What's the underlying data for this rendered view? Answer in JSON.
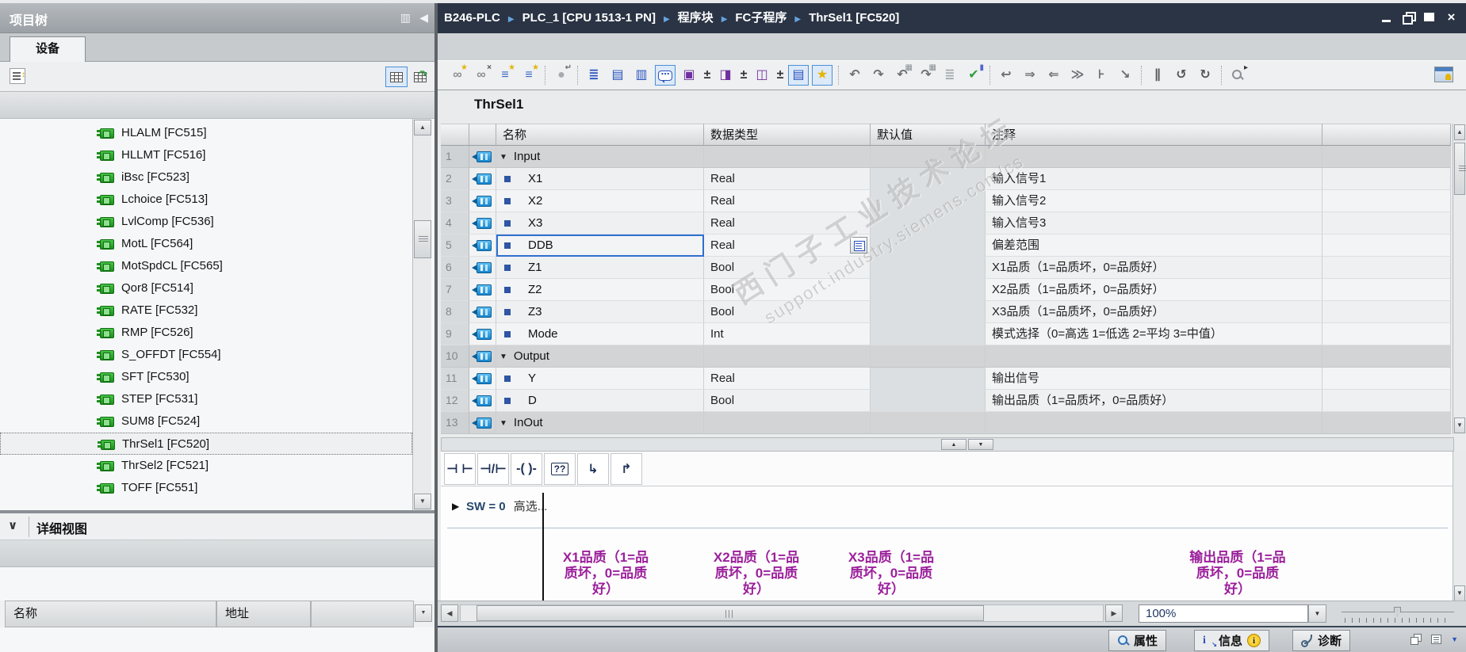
{
  "window": {
    "breadcrumb": [
      "B246-PLC",
      "PLC_1 [CPU 1513-1 PN]",
      "程序块",
      "FC子程序",
      "ThrSel1 [FC520]"
    ],
    "controls": [
      "minimize",
      "restore",
      "maximize",
      "close"
    ]
  },
  "project_tree": {
    "title": "项目树",
    "tab_label": "设备",
    "items": [
      "HLALM [FC515]",
      "HLLMT [FC516]",
      "iBsc [FC523]",
      "Lchoice [FC513]",
      "LvlComp [FC536]",
      "MotL [FC564]",
      "MotSpdCL [FC565]",
      "Qor8 [FC514]",
      "RATE [FC532]",
      "RMP [FC526]",
      "S_OFFDT [FC554]",
      "SFT [FC530]",
      "STEP [FC531]",
      "SUM8 [FC524]",
      "ThrSel1 [FC520]",
      "ThrSel2 [FC521]",
      "TOFF [FC551]"
    ],
    "selected_item": "ThrSel1 [FC520]",
    "detail_view": {
      "title": "详细视图",
      "columns": [
        "名称",
        "地址"
      ]
    }
  },
  "editor": {
    "block_title": "ThrSel1",
    "interface_table": {
      "columns": [
        "名称",
        "数据类型",
        "默认值",
        "注释"
      ],
      "rows": [
        {
          "num": "1",
          "name": "Input",
          "type": "",
          "default": "",
          "comment": "",
          "section": true
        },
        {
          "num": "2",
          "name": "X1",
          "type": "Real",
          "default": "",
          "comment": "输入信号1"
        },
        {
          "num": "3",
          "name": "X2",
          "type": "Real",
          "default": "",
          "comment": "输入信号2"
        },
        {
          "num": "4",
          "name": "X3",
          "type": "Real",
          "default": "",
          "comment": "输入信号3"
        },
        {
          "num": "5",
          "name": "DDB",
          "type": "Real",
          "default": "",
          "comment": "偏差范围",
          "editing": true
        },
        {
          "num": "6",
          "name": "Z1",
          "type": "Bool",
          "default": "",
          "comment": "X1品质（1=品质坏，0=品质好）"
        },
        {
          "num": "7",
          "name": "Z2",
          "type": "Bool",
          "default": "",
          "comment": "X2品质（1=品质坏，0=品质好）"
        },
        {
          "num": "8",
          "name": "Z3",
          "type": "Bool",
          "default": "",
          "comment": "X3品质（1=品质坏，0=品质好）"
        },
        {
          "num": "9",
          "name": "Mode",
          "type": "Int",
          "default": "",
          "comment": "模式选择（0=高选 1=低选 2=平均 3=中值）"
        },
        {
          "num": "10",
          "name": "Output",
          "type": "",
          "default": "",
          "comment": "",
          "section": true
        },
        {
          "num": "11",
          "name": "Y",
          "type": "Real",
          "default": "",
          "comment": "输出信号"
        },
        {
          "num": "12",
          "name": "D",
          "type": "Bool",
          "default": "",
          "comment": "输出品质（1=品质坏，0=品质好）"
        },
        {
          "num": "13",
          "name": "InOut",
          "type": "",
          "default": "",
          "comment": "",
          "section": true
        }
      ]
    },
    "toolbar_icons": [
      {
        "name": "insert-watch-icon",
        "glyph": "∞",
        "color": "#8a8f94",
        "badge": "★",
        "badge_color": "#e3b505"
      },
      {
        "name": "delete-watch-icon",
        "glyph": "∞",
        "color": "#8a8f94",
        "badge": "×",
        "badge_color": "#555555"
      },
      {
        "name": "insert-row-icon",
        "glyph": "≡",
        "color": "#3a66c4",
        "badge": "★",
        "badge_color": "#e3b505"
      },
      {
        "name": "add-row-after-icon",
        "glyph": "≡",
        "color": "#3a66c4",
        "badge": "★",
        "badge_color": "#e3b505"
      },
      {
        "separator": true
      },
      {
        "name": "keep-actual-values-icon",
        "glyph": "●",
        "color": "#a6abb0",
        "badge": "↵",
        "badge_color": "#666666"
      },
      {
        "separator": true
      },
      {
        "name": "network-sequence-icon",
        "glyph": "≣",
        "color": "#2a52be"
      },
      {
        "name": "open-all-networks-icon",
        "glyph": "▤",
        "color": "#2a52be"
      },
      {
        "name": "close-all-networks-icon",
        "glyph": "▥",
        "color": "#2a52be"
      },
      {
        "name": "comments-toggle-icon",
        "glyph": "⋯",
        "color": "#2a52be",
        "bubble": true,
        "toggled": true
      },
      {
        "name": "tag-info-icon",
        "glyph": "▣",
        "color": "#7030a0"
      },
      {
        "name": "tag-info-expand-icon",
        "glyph": "±",
        "color": "#333333",
        "narrow": true
      },
      {
        "name": "tag-comment-icon",
        "glyph": "◨",
        "color": "#7030a0"
      },
      {
        "name": "tag-comment-expand-icon",
        "glyph": "±",
        "color": "#333333",
        "narrow": true
      },
      {
        "name": "tag-address-icon",
        "glyph": "◫",
        "color": "#7030a0"
      },
      {
        "name": "tag-address-expand-icon",
        "glyph": "±",
        "color": "#333333",
        "narrow": true
      },
      {
        "name": "absolute-operands-toggle-icon",
        "glyph": "▤",
        "color": "#2a52be",
        "toggled": true
      },
      {
        "name": "favorites-toggle-icon",
        "glyph": "★",
        "color": "#e3b505",
        "toggled": true
      },
      {
        "separator": true
      },
      {
        "name": "undo-icon",
        "glyph": "↶",
        "color": "#6b7075"
      },
      {
        "name": "redo-icon",
        "glyph": "↷",
        "color": "#6b7075"
      },
      {
        "name": "download-to-device-icon",
        "glyph": "↶",
        "color": "#6b7075",
        "badge": "▦",
        "badge_color": "#8a8f94"
      },
      {
        "name": "upload-from-device-icon",
        "glyph": "↷",
        "color": "#6b7075",
        "badge": "▦",
        "badge_color": "#8a8f94"
      },
      {
        "name": "compare-icon",
        "glyph": "≣",
        "color": "#a6abb0"
      },
      {
        "name": "compile-icon",
        "glyph": "✔",
        "color": "#2e9e3f",
        "badge": "▮",
        "badge_color": "#5566cc"
      },
      {
        "separator": true
      },
      {
        "name": "goto-definition-icon",
        "glyph": "↩",
        "color": "#6b7075"
      },
      {
        "name": "goto-next-usage-icon",
        "glyph": "⇒",
        "color": "#6b7075"
      },
      {
        "name": "goto-previous-usage-icon",
        "glyph": "⇐",
        "color": "#6b7075"
      },
      {
        "name": "update-block-calls-icon",
        "glyph": "≫",
        "color": "#6b7075"
      },
      {
        "name": "insert-network-icon",
        "glyph": "⊦",
        "color": "#6b7075"
      },
      {
        "name": "delete-network-icon",
        "glyph": "↘",
        "color": "#6b7075"
      },
      {
        "separator": true
      },
      {
        "name": "pause-icon",
        "glyph": "∥",
        "color": "#555555"
      },
      {
        "name": "jump-back-icon",
        "glyph": "↺",
        "color": "#555555"
      },
      {
        "name": "jump-forward-icon",
        "glyph": "↻",
        "color": "#555555"
      },
      {
        "separator": true
      },
      {
        "name": "search-icon",
        "magnifier": true,
        "badge": "▸",
        "badge_color": "#333333"
      }
    ],
    "ladder_toolbar": [
      {
        "name": "no-contact-button",
        "label": "⊣ ⊢"
      },
      {
        "name": "nc-contact-button",
        "label": "⊣/⊢"
      },
      {
        "name": "coil-button",
        "label": "-( )-"
      },
      {
        "name": "empty-box-button",
        "label": "??",
        "boxed": true
      },
      {
        "name": "open-branch-button",
        "label": "↳"
      },
      {
        "name": "close-branch-button",
        "label": "↱"
      }
    ],
    "network": {
      "title_prefix": "SW = 0",
      "title_suffix": "高选...",
      "operand_comments": [
        "X1品质（1=品质坏，0=品质好）",
        "X2品质（1=品质坏，0=品质好）",
        "X3品质（1=品质坏，0=品质好）",
        "输出品质（1=品质坏，0=品质好）"
      ],
      "comment_color": "#9B1F9B"
    },
    "watermark": {
      "line1": "西门子工业技术论坛",
      "line2": "support.industry.siemens.com/cs"
    },
    "zoom_value": "100%"
  },
  "status_bar": {
    "tabs": [
      {
        "label": "属性",
        "icon": "magnifier-icon"
      },
      {
        "label": "信息",
        "icon": "info-icon",
        "badge": "i",
        "active": true
      },
      {
        "label": "诊断",
        "icon": "stethoscope-icon"
      }
    ]
  },
  "colors": {
    "accent_blue": "#2a52be",
    "breadcrumb_bg": "#2a3444",
    "fc_icon_green": "#2ca12c",
    "selection_blue": "#2f6fd0",
    "comment_purple": "#9B1F9B"
  }
}
